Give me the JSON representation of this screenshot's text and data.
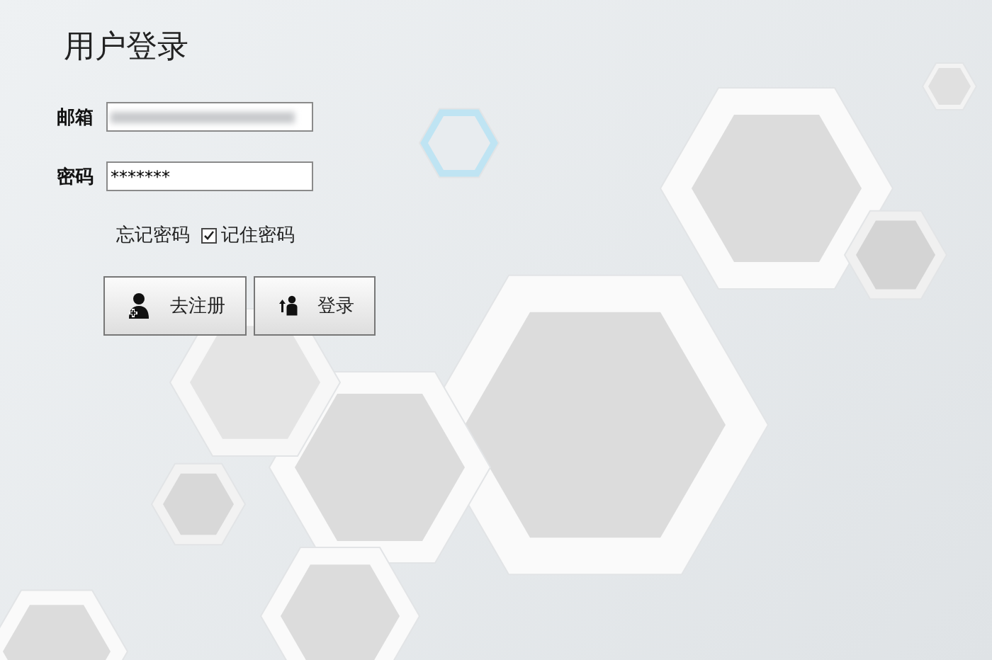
{
  "title": "用户登录",
  "fields": [
    {
      "label": "邮箱",
      "blurred": true
    },
    {
      "label": "密码",
      "blurred": false,
      "value": "*******"
    }
  ],
  "forgot_link": "忘记密码",
  "remember": {
    "label": "记住密码",
    "checked": true
  },
  "buttons": [
    {
      "label": "去注册",
      "kind": "register"
    },
    {
      "label": "登录",
      "kind": "login"
    }
  ]
}
